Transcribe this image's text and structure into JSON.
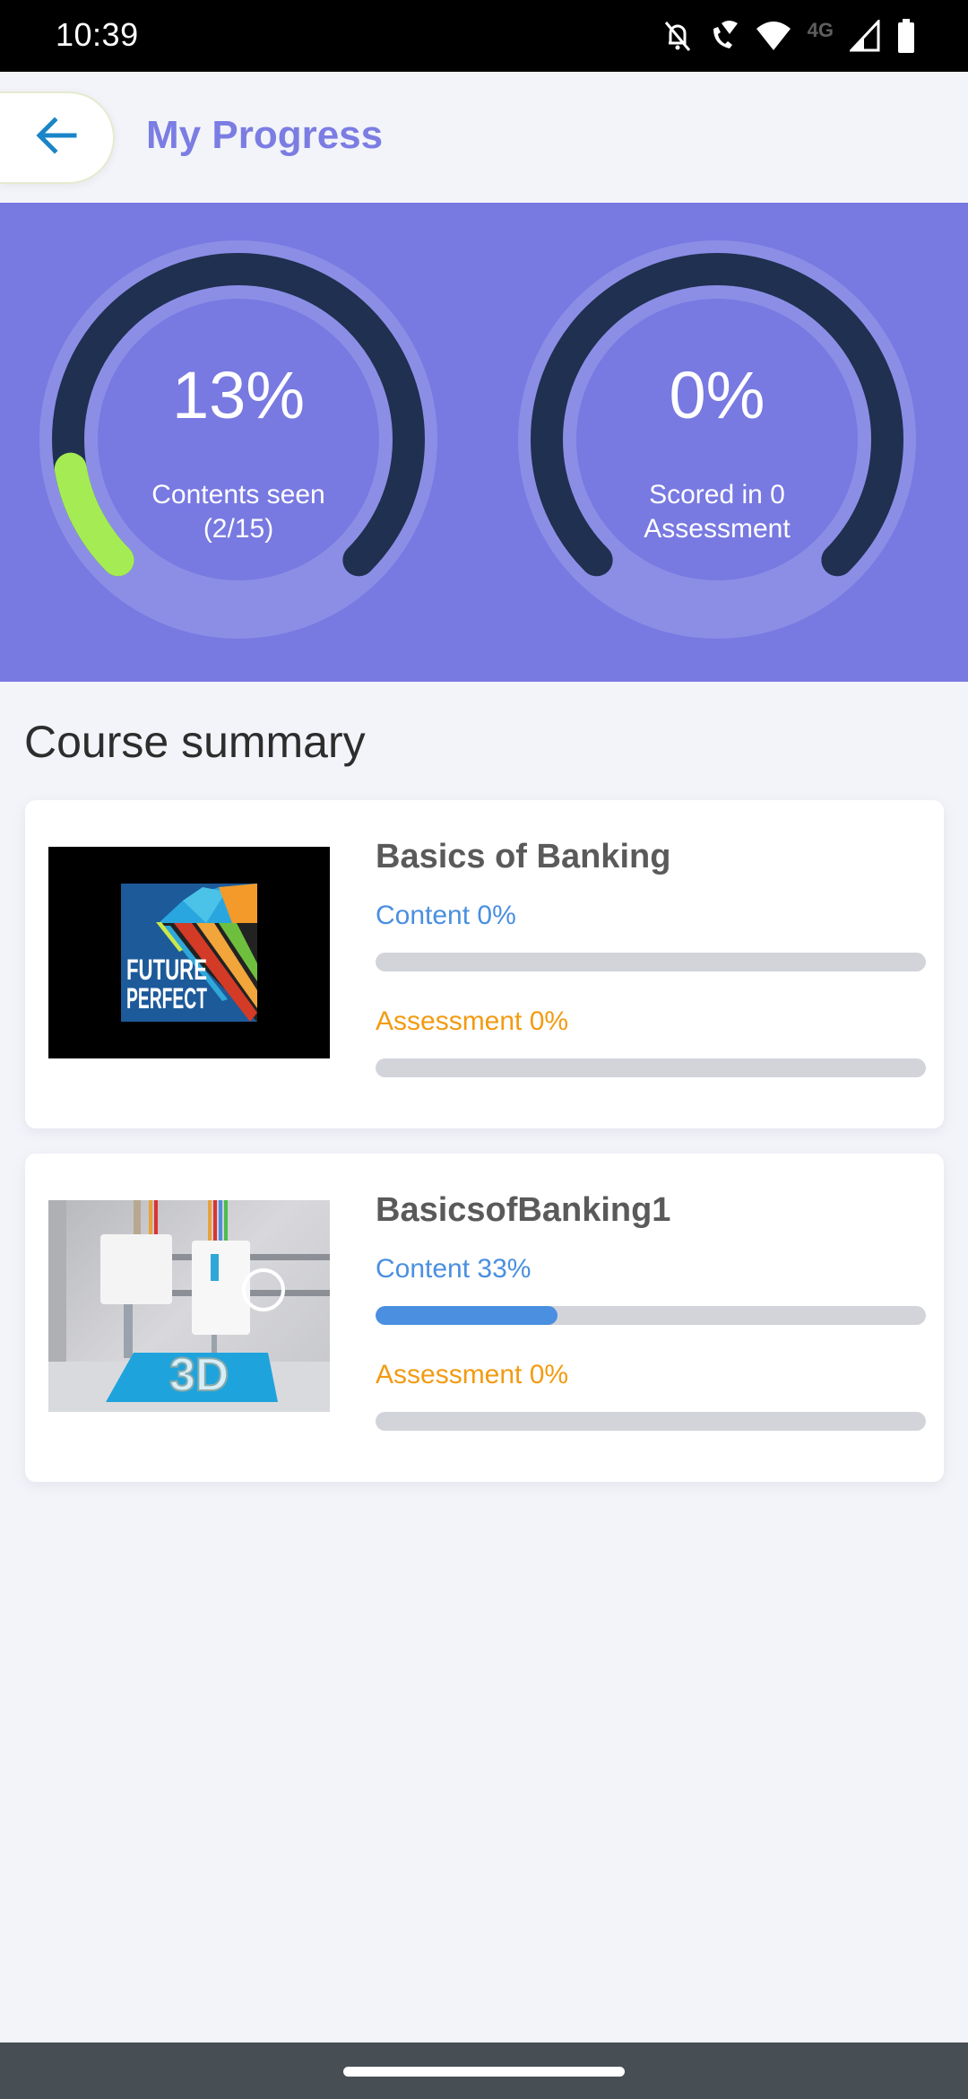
{
  "status_bar": {
    "time": "10:39",
    "network_label": "4G",
    "icons": [
      "bell-off-icon",
      "wifi-calling-icon",
      "wifi-icon",
      "cellular-signal-icon",
      "battery-icon"
    ]
  },
  "header": {
    "back_icon": "arrow-left-icon",
    "title": "My Progress"
  },
  "overview": {
    "colors": {
      "banner": "#7879e1",
      "track": "#1f3050",
      "progress": "#a5ec54",
      "halo": "#8c8ee6"
    },
    "gauges": [
      {
        "id": "contents",
        "value_text": "13%",
        "value": 0.13,
        "label": "Contents seen (2/15)"
      },
      {
        "id": "assessment",
        "value_text": "0%",
        "value": 0.0,
        "label": "Scored in 0 Assessment"
      }
    ]
  },
  "course_summary": {
    "title": "Course summary",
    "courses": [
      {
        "title": "Basics of Banking",
        "thumbnail": "future-perfect-image",
        "thumbnail_text": [
          "FUTURE",
          "PERFECT"
        ],
        "content_label": "Content 0%",
        "content_value": 0.0,
        "assessment_label": "Assessment 0%",
        "assessment_value": 0.0
      },
      {
        "title": "BasicsofBanking1",
        "thumbnail": "3d-printer-image",
        "thumbnail_text": [
          "3D"
        ],
        "content_label": "Content 33%",
        "content_value": 0.33,
        "assessment_label": "Assessment 0%",
        "assessment_value": 0.0
      }
    ],
    "colors": {
      "content": "#4a8fe0",
      "assessment": "#f29b12",
      "bar_track": "#d3d4da"
    }
  },
  "nav_bar": {
    "handle": "home-gesture-handle"
  }
}
